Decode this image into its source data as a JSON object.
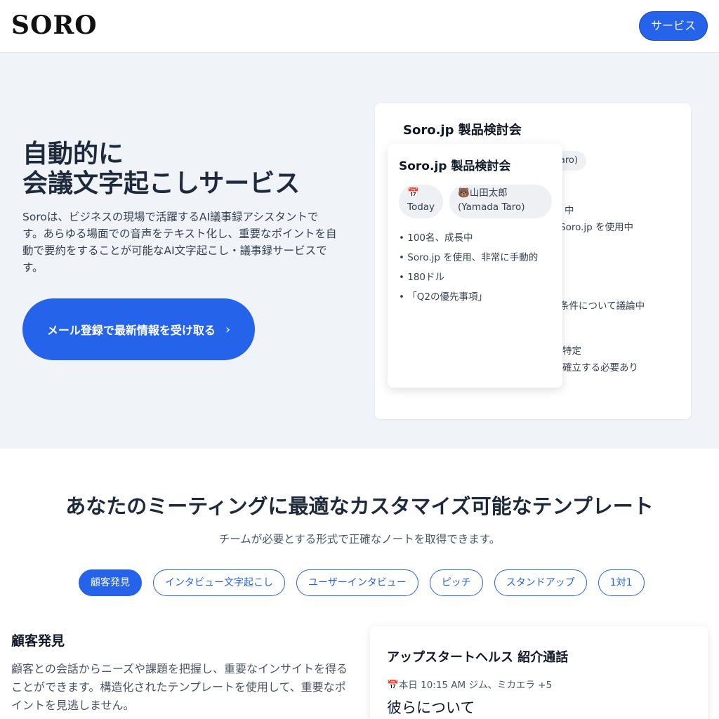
{
  "header": {
    "logo": "SORO",
    "nav_button": "サービス"
  },
  "hero": {
    "title_line1": "自動的に",
    "title_line2": "会議文字起こしサービス",
    "description": "Soroは、ビジネスの現場で活躍するAI議事録アシスタントです。あらゆる場面での音声をテキスト化し、重要なポイントを自動で要約をすることが可能なAI文字起こし・議事録サービスです。",
    "cta_label": "メール登録で最新情報を受け取る",
    "cta_chevron": "›"
  },
  "back_card": {
    "title": "Soro.jp 製品検討会",
    "pill_peek": "a Taro)",
    "peek_lines": [
      "中",
      "Soro.jp を使用中",
      "条件について議論中",
      "特定",
      "確立する必要あり"
    ]
  },
  "front_card": {
    "title": "Soro.jp 製品検討会",
    "date_icon": "📅",
    "date": "Today",
    "user_icon": "🐻",
    "user_name": "山田太郎",
    "user_name_en": "(Yamada Taro)",
    "bullets": [
      "• 100名、成長中",
      "• Soro.jp を使用、非常に手動的",
      "• 180ドル",
      "• 「Q2の優先事項」"
    ]
  },
  "templates": {
    "title": "あなたのミーティングに最適なカスタマイズ可能なテンプレート",
    "subtitle": "チームが必要とする形式で正確なノートを取得できます。",
    "tabs": [
      "顧客発見",
      "インタビュー文字起こし",
      "ユーザーインタビュー",
      "ピッチ",
      "スタンドアップ",
      "1対1"
    ],
    "active_tab": "顧客発見",
    "selected_title": "顧客発見",
    "selected_description": "顧客との会話からニーズや課題を把握し、重要なインサイトを得ることができます。構造化されたテンプレートを使用して、重要なポイントを見逃しません。"
  },
  "preview": {
    "title": "アップスタートヘルス 紹介通話",
    "meta_icon": "📅",
    "meta": "本日 10:15 AM ジム、ミカエラ +5",
    "heading": "彼らについて"
  },
  "colors": {
    "accent": "#2563eb",
    "hero_bg": "#f0f3f8"
  }
}
